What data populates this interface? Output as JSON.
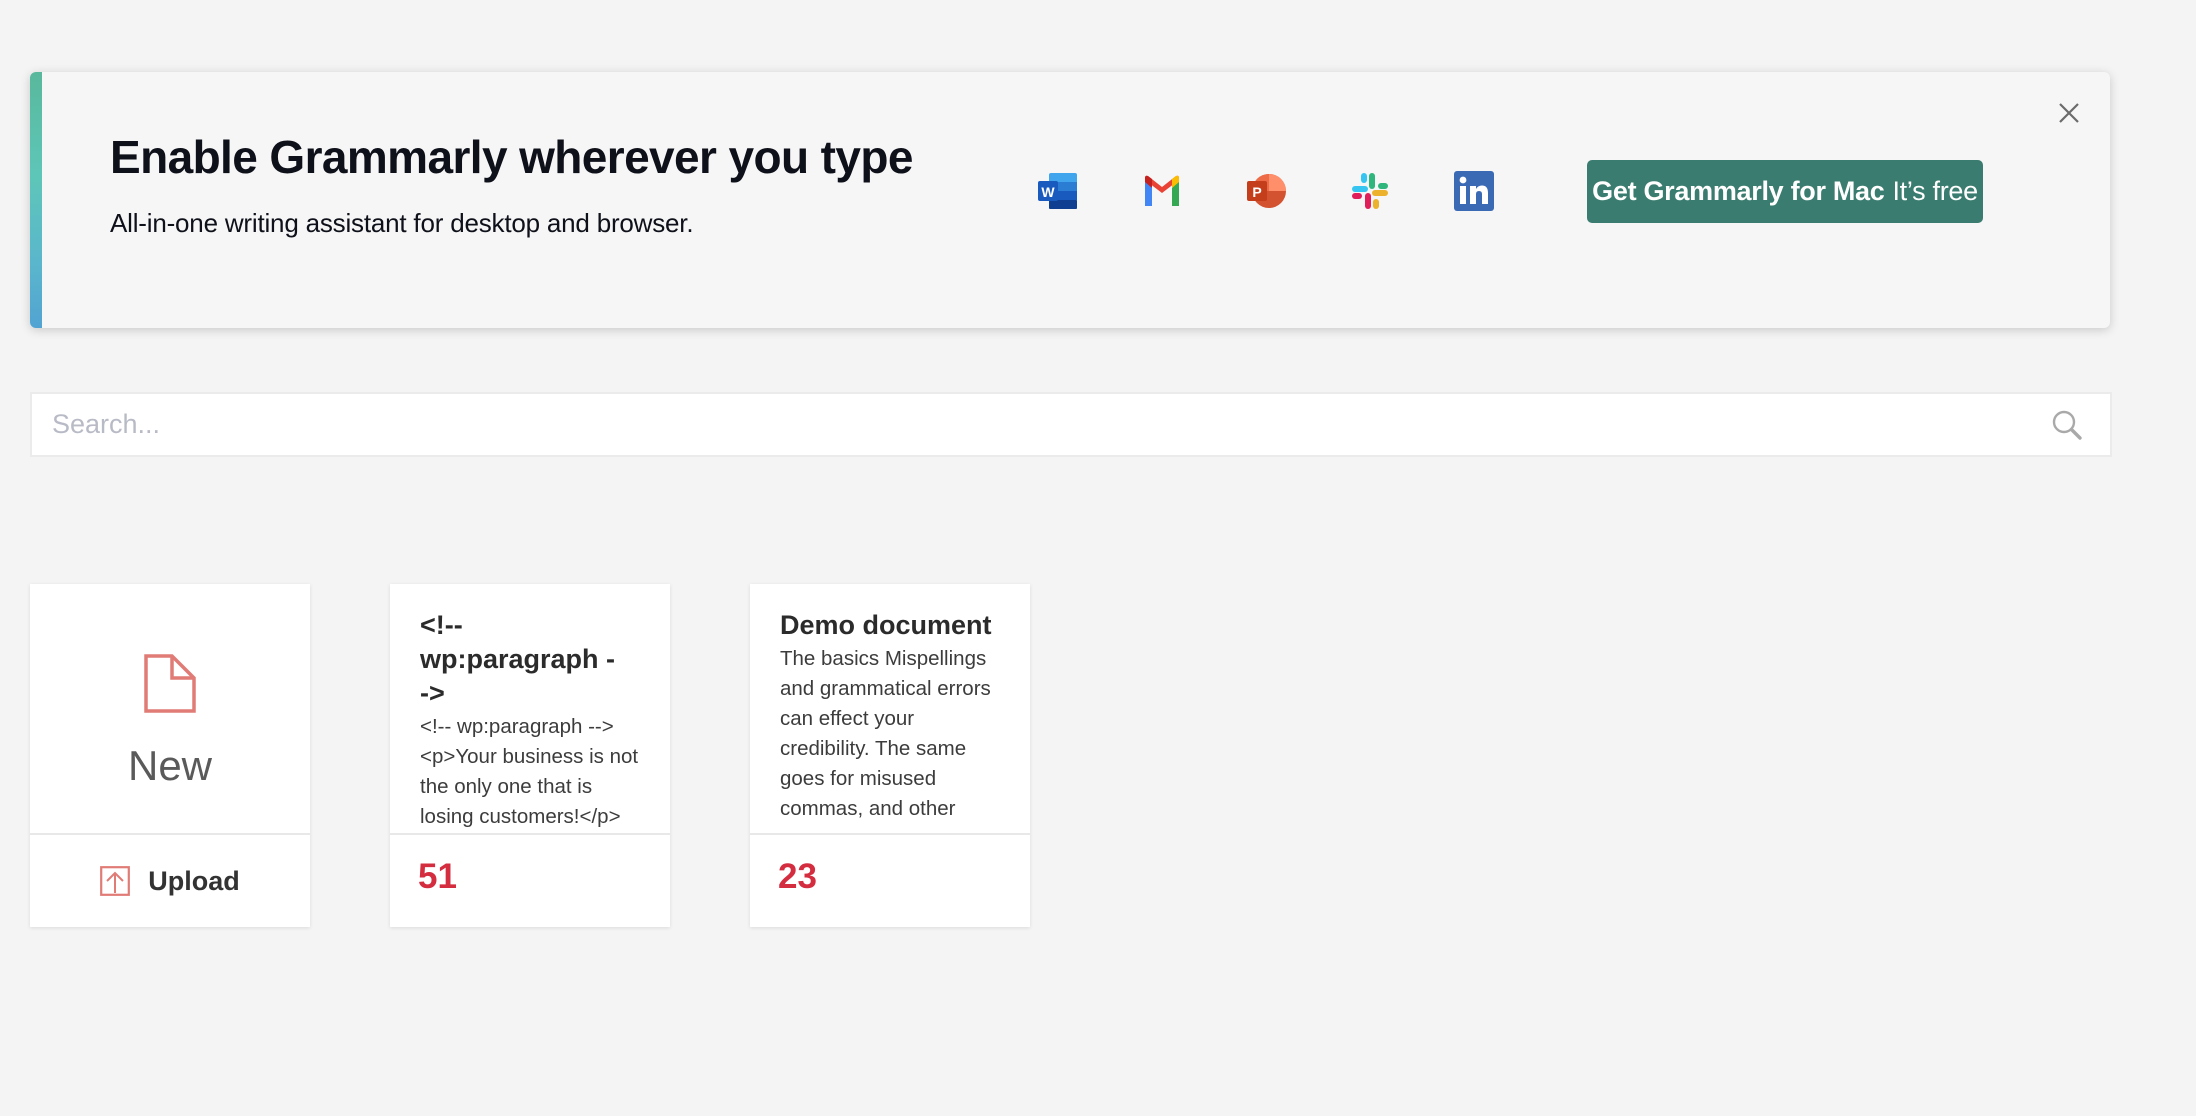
{
  "banner": {
    "title": "Enable Grammarly wherever you type",
    "subtitle": "All-in-one writing assistant for desktop and browser.",
    "apps": [
      {
        "name": "Microsoft Word",
        "icon": "word-icon"
      },
      {
        "name": "Gmail",
        "icon": "gmail-icon"
      },
      {
        "name": "Microsoft PowerPoint",
        "icon": "powerpoint-icon"
      },
      {
        "name": "Slack",
        "icon": "slack-icon"
      },
      {
        "name": "LinkedIn",
        "icon": "linkedin-icon"
      }
    ],
    "cta_bold": "Get Grammarly for Mac",
    "cta_light": "It’s free",
    "close_icon": "close-icon",
    "accent_gradient": [
      "#58b89c",
      "#52a3d2"
    ],
    "cta_color": "#3a7c6f"
  },
  "search": {
    "placeholder": "Search...",
    "value": "",
    "icon": "search-icon"
  },
  "new_card": {
    "label": "New",
    "upload_label": "Upload",
    "icon_color": "#e07b76"
  },
  "documents": [
    {
      "title": "<!-- wp:paragraph -->",
      "preview": "<!-- wp:paragraph --> <p>Your business is not the only one that is losing customers!</p> <!-- /wp:paragraph -->",
      "score": "51"
    },
    {
      "title": "Demo document",
      "preview": "The basics Mispellings and grammatical errors can effect your credibility. The same goes for misused commas, and other",
      "score": "23"
    }
  ],
  "score_color": "#d42d3f"
}
